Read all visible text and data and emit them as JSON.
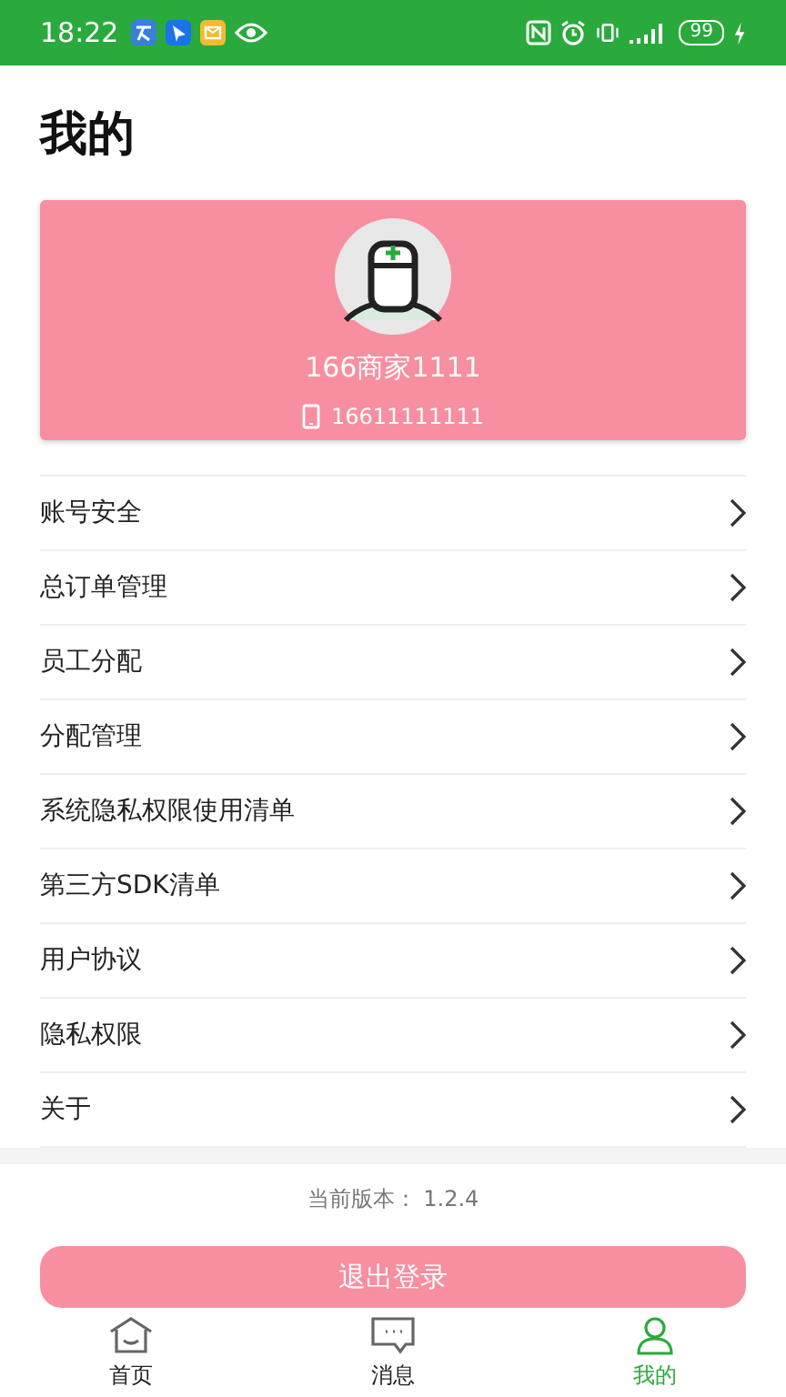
{
  "status_bar": {
    "time": "18:22",
    "battery": "99"
  },
  "title": "我的",
  "profile": {
    "name": "166商家1111",
    "phone": "16611111111"
  },
  "menu": [
    {
      "label": "账号安全"
    },
    {
      "label": "总订单管理"
    },
    {
      "label": "员工分配"
    },
    {
      "label": "分配管理"
    },
    {
      "label": "系统隐私权限使用清单"
    },
    {
      "label": "第三方SDK清单"
    },
    {
      "label": "用户协议"
    },
    {
      "label": "隐私权限"
    },
    {
      "label": "关于"
    }
  ],
  "version": "当前版本：  1.2.4",
  "logout": "退出登录",
  "tabs": [
    {
      "label": "首页",
      "kind": "home",
      "selected": false
    },
    {
      "label": "消息",
      "kind": "message",
      "selected": false
    },
    {
      "label": "我的",
      "kind": "me",
      "selected": true
    }
  ]
}
